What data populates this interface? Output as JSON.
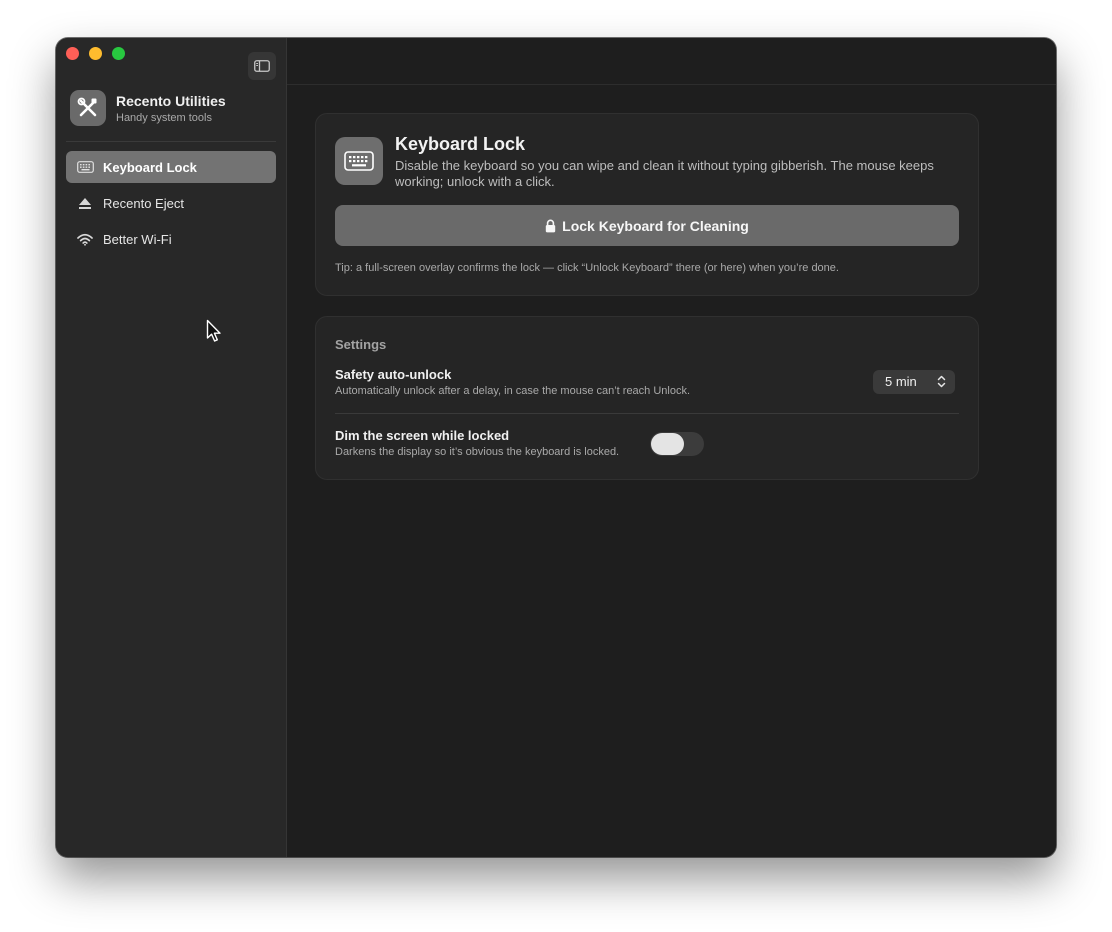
{
  "window": {
    "traffic_lights": [
      "close",
      "minimize",
      "maximize"
    ],
    "colors": {
      "close": "#fe5f57",
      "minimize": "#febc2e",
      "maximize": "#28c840"
    }
  },
  "sidebar": {
    "toggle_icon": "sidebar-toggle-icon",
    "app": {
      "name": "Recento Utilities",
      "subtitle": "Handy system tools",
      "icon": "tools-icon"
    },
    "items": [
      {
        "label": "Keyboard Lock",
        "icon": "keyboard-icon",
        "active": true
      },
      {
        "label": "Recento Eject",
        "icon": "eject-icon",
        "active": false
      },
      {
        "label": "Better Wi-Fi",
        "icon": "wifi-icon",
        "active": false
      }
    ]
  },
  "main": {
    "hero": {
      "icon": "keyboard-icon",
      "title": "Keyboard Lock",
      "description": "Disable the keyboard so you can wipe and clean it without typing gibberish. The mouse keeps working; unlock with a click.",
      "button_label": "Lock Keyboard for Cleaning",
      "button_icon": "lock-icon",
      "tip": "Tip: a full-screen overlay confirms the lock — click “Unlock Keyboard” there (or here) when you’re done."
    },
    "settings": {
      "heading": "Settings",
      "rows": [
        {
          "title": "Safety auto-unlock",
          "description": "Automatically unlock after a delay, in case the mouse can’t reach Unlock.",
          "control": "popup",
          "value": "5 min"
        },
        {
          "title": "Dim the screen while locked",
          "description": "Darkens the display so it’s obvious the keyboard is locked.",
          "control": "toggle",
          "on": false
        }
      ]
    }
  }
}
